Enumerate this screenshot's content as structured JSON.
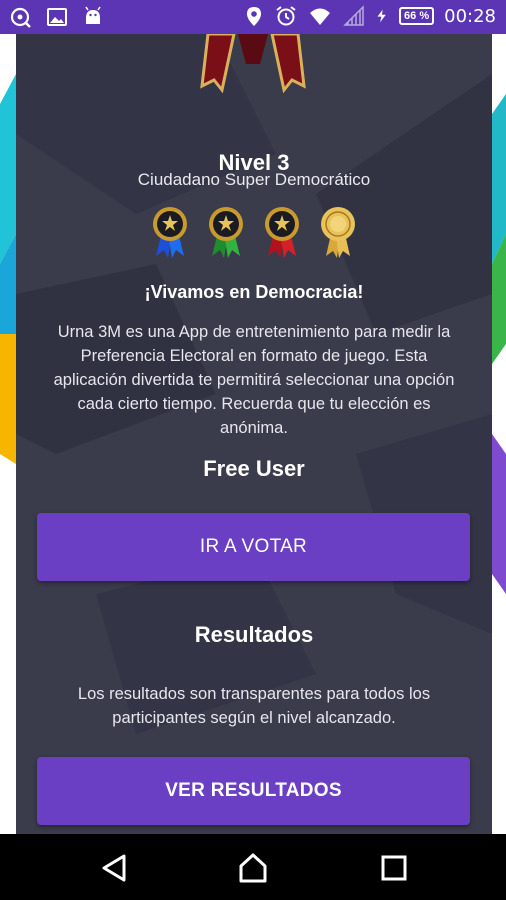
{
  "status_bar": {
    "battery": "66 %",
    "time": "00:28",
    "icons": [
      "app-notification-icon",
      "image-icon",
      "android-icon",
      "location-icon",
      "alarm-icon",
      "wifi-icon",
      "signal-icon",
      "charging-icon"
    ]
  },
  "level": {
    "title": "Nivel 3",
    "name": "Ciudadano Super Democrático",
    "medals": [
      "blue-medal-icon",
      "green-medal-icon",
      "red-medal-icon",
      "gold-seal-icon"
    ]
  },
  "intro": {
    "headline": "¡Vivamos en Democracia!",
    "description": "Urna 3M es una App de entretenimiento para medir la Preferencia Electoral en formato de juego. Esta aplicación divertida te permitirá seleccionar una opción cada cierto tiempo. Recuerda que tu elección es anónima."
  },
  "user": {
    "type": "Free User"
  },
  "actions": {
    "vote_label": "IR A VOTAR",
    "results_label": "VER RESULTADOS"
  },
  "results": {
    "title": "Resultados",
    "description": "Los resultados son transparentes para todos los participantes según el nivel alcanzado."
  },
  "colors": {
    "status_bar": "#5c35b5",
    "card_background": "#3a3c4c",
    "button": "#6a3fc4"
  },
  "nav_bar": {
    "icons": [
      "back-icon",
      "home-icon",
      "recents-icon"
    ]
  }
}
